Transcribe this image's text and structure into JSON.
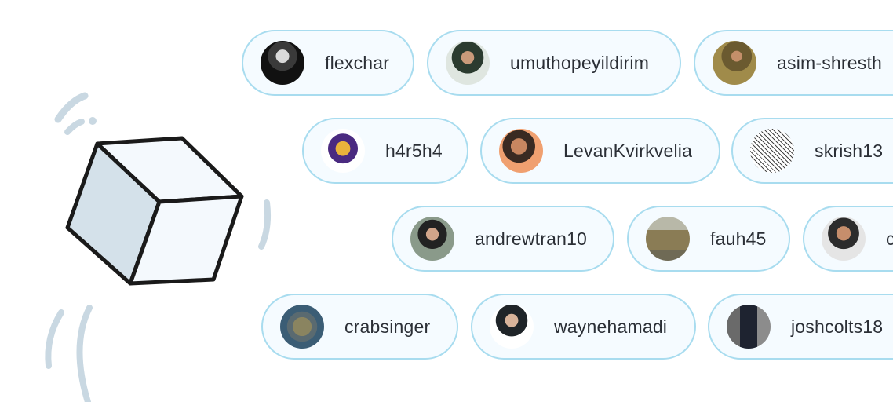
{
  "contributors": [
    [
      {
        "name": "flexchar",
        "avatar": "flexchar-avatar"
      },
      {
        "name": "umuthopeyildirim",
        "avatar": "umuthopeyildirim-avatar"
      },
      {
        "name": "asim-shresth",
        "avatar": "asim-shrestha-avatar"
      }
    ],
    [
      {
        "name": "h4r5h4",
        "avatar": "h4r5h4-avatar"
      },
      {
        "name": "LevanKvirkvelia",
        "avatar": "levankvirkvelia-avatar"
      },
      {
        "name": "skrish13",
        "avatar": "skrish13-avatar"
      }
    ],
    [
      {
        "name": "andrewtran10",
        "avatar": "andrewtran10-avatar"
      },
      {
        "name": "fauh45",
        "avatar": "fauh45-avatar"
      },
      {
        "name": "c",
        "avatar": "cut-off-user-avatar"
      }
    ],
    [
      {
        "name": "crabsinger",
        "avatar": "crabsinger-avatar"
      },
      {
        "name": "waynehamadi",
        "avatar": "waynehamadi-avatar"
      },
      {
        "name": "joshcolts18",
        "avatar": "joshcolts18-avatar"
      }
    ]
  ],
  "colors": {
    "pill_border": "#a8dcef",
    "pill_fill": "#f5fbff",
    "cube_stroke": "#1a1a1a",
    "cube_side": "#d4e1ea",
    "motion_lines": "#c9d8e2"
  }
}
